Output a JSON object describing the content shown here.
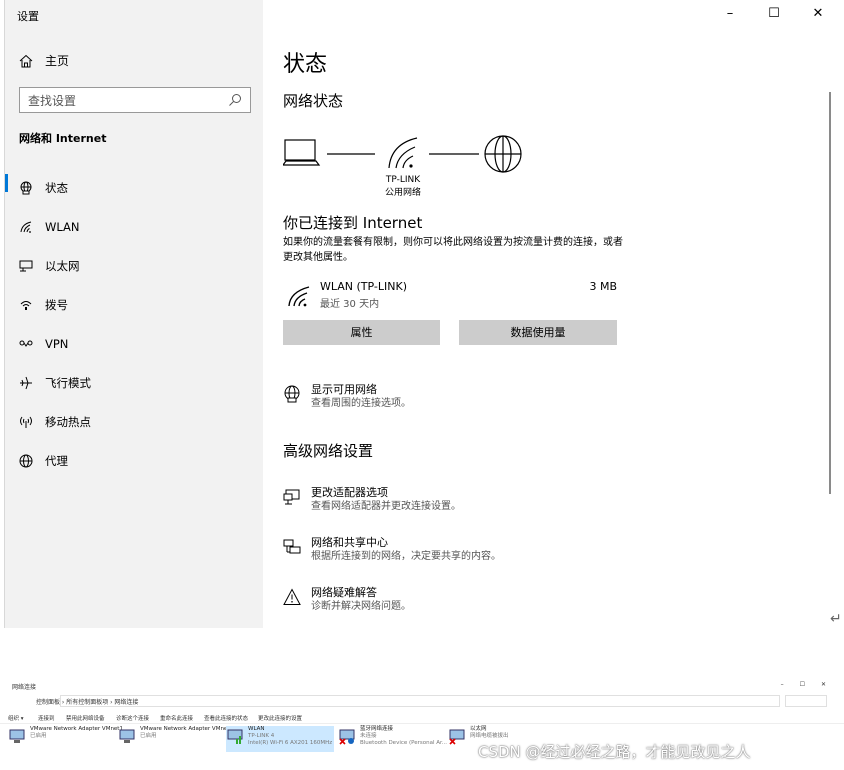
{
  "app": {
    "title": "设置",
    "window_controls": {
      "minimize": "–",
      "maximize": "☐",
      "close": "✕"
    }
  },
  "sidebar": {
    "home_label": "主页",
    "search_placeholder": "查找设置",
    "category_heading": "网络和 Internet",
    "items": [
      {
        "label": "状态",
        "icon": "globe-network-icon",
        "active": true
      },
      {
        "label": "WLAN",
        "icon": "wifi-icon",
        "active": false
      },
      {
        "label": "以太网",
        "icon": "ethernet-icon",
        "active": false
      },
      {
        "label": "拨号",
        "icon": "dialup-icon",
        "active": false
      },
      {
        "label": "VPN",
        "icon": "vpn-icon",
        "active": false
      },
      {
        "label": "飞行模式",
        "icon": "airplane-icon",
        "active": false
      },
      {
        "label": "移动热点",
        "icon": "hotspot-icon",
        "active": false
      },
      {
        "label": "代理",
        "icon": "globe-icon",
        "active": false
      }
    ]
  },
  "main": {
    "page_title": "状态",
    "network_status_title": "网络状态",
    "diagram": {
      "network_name": "TP-LINK",
      "network_type": "公用网络"
    },
    "connected_title": "你已连接到 Internet",
    "connected_desc": "如果你的流量套餐有限制，则你可以将此网络设置为按流量计费的连接，或者更改其他属性。",
    "connection": {
      "name": "WLAN (TP-LINK)",
      "sub": "最近 30 天内",
      "usage": "3 MB"
    },
    "buttons": {
      "properties": "属性",
      "data_usage": "数据使用量"
    },
    "show_networks": {
      "title": "显示可用网络",
      "desc": "查看周围的连接选项。"
    },
    "advanced_title": "高级网络设置",
    "advanced_items": [
      {
        "title": "更改适配器选项",
        "desc": "查看网络适配器并更改连接设置。",
        "icon": "adapter-icon"
      },
      {
        "title": "网络和共享中心",
        "desc": "根据所连接到的网络，决定要共享的内容。",
        "icon": "sharing-center-icon"
      },
      {
        "title": "网络疑难解答",
        "desc": "诊断并解决网络问题。",
        "icon": "warning-icon"
      }
    ],
    "return_glyph": "↵"
  },
  "explorer": {
    "title": "网络连接",
    "window_controls": {
      "minimize": "–",
      "maximize": "☐",
      "close": "✕"
    },
    "path": "控制面板 › 所有控制面板项 › 网络连接",
    "commands": [
      "组织 ▾",
      "连接到",
      "禁用此网络设备",
      "诊断这个连接",
      "重命名此连接",
      "查看此连接的状态",
      "更改此连接的设置"
    ],
    "adapters": [
      {
        "name": "VMware Network Adapter VMnet1",
        "status": "已启用",
        "device": ""
      },
      {
        "name": "VMware Network Adapter VMnet8",
        "status": "已启用",
        "device": ""
      },
      {
        "name": "WLAN",
        "status": "TP-LINK 4",
        "device": "Intel(R) Wi-Fi 6 AX201 160MHz"
      },
      {
        "name": "蓝牙网络连接",
        "status": "未连接",
        "device": "Bluetooth Device (Personal Ar..."
      },
      {
        "name": "以太网",
        "status": "网络电缆被拔出",
        "device": ""
      }
    ]
  },
  "watermark": "CSDN @经过必经之路，才能见改见之人"
}
